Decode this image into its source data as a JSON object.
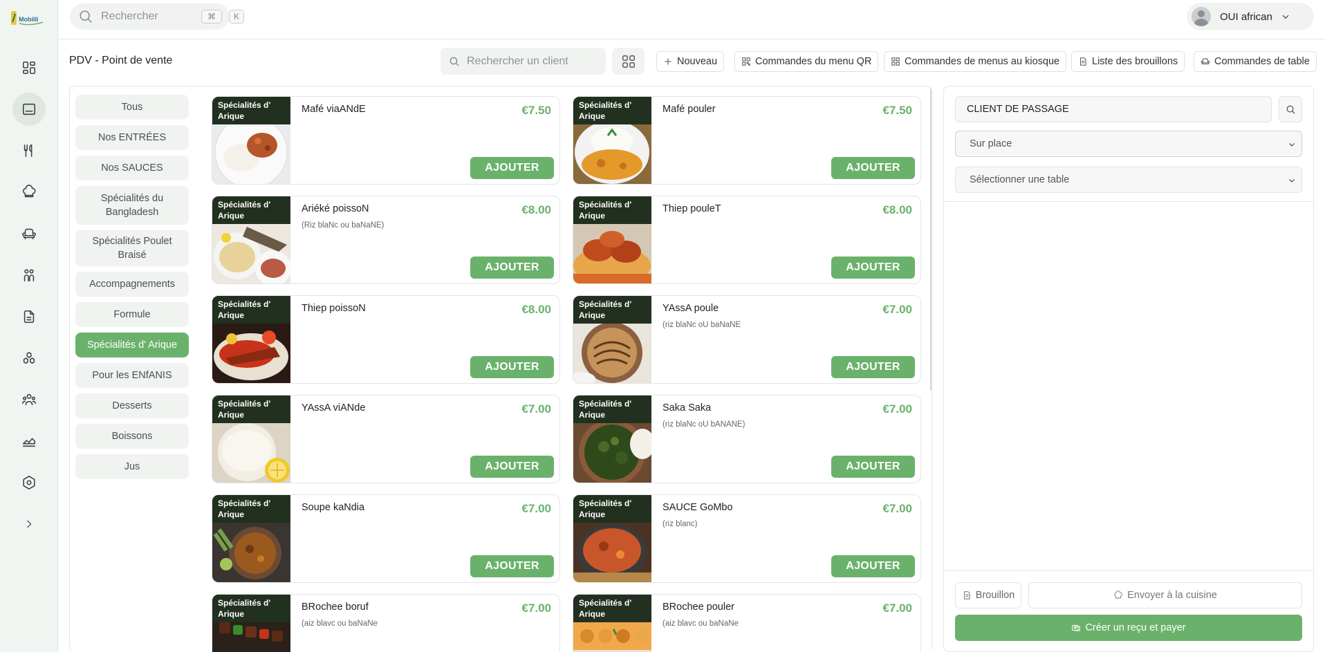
{
  "app": {
    "logo_text": "Mobilli"
  },
  "topbar": {
    "search_placeholder": "Rechercher",
    "shortcut_mod": "⌘",
    "shortcut_key": "K",
    "user_name": "OUI african"
  },
  "nav_icons": [
    "dashboard-icon",
    "pos-icon",
    "utensils-icon",
    "chef-hat-icon",
    "armchair-icon",
    "users-icon",
    "document-icon",
    "stock-icon",
    "team-icon",
    "analytics-icon",
    "settings-icon",
    "expand-icon"
  ],
  "header": {
    "title": "PDV - Point de vente",
    "client_search_placeholder": "Rechercher un client",
    "buttons": {
      "new": "Nouveau",
      "qr_orders": "Commandes du menu QR",
      "kiosk_orders": "Commandes de menus au kiosque",
      "drafts": "Liste des brouillons",
      "table_orders": "Commandes de table"
    }
  },
  "categories": [
    "Tous",
    "Nos ENTRÉES",
    "Nos SAUCES",
    "Spécialités du Bangladesh",
    "Spécialités Poulet Braisé",
    "Accompagnements",
    "Formule",
    "Spécialités d' Arique",
    "Pour les ENfANIS",
    "Desserts",
    "Boissons",
    "Jus"
  ],
  "active_category": "Spécialités d' Arique",
  "product_tag": "Spécialités d' Arique",
  "add_label": "AJOUTER",
  "products": [
    {
      "name": "Mafé viaANdE",
      "desc": "",
      "price": "€7.50",
      "img": "meat-rice"
    },
    {
      "name": "Mafé pouler",
      "desc": "",
      "price": "€7.50",
      "img": "curry-rice"
    },
    {
      "name": "Ariéké poissoN",
      "desc": "(Riz blaNc ou baNaNE)",
      "price": "€8.00",
      "img": "fish-plate"
    },
    {
      "name": "Thiep pouleT",
      "desc": "",
      "price": "€8.00",
      "img": "chicken"
    },
    {
      "name": "Thiep poissoN",
      "desc": "",
      "price": "€8.00",
      "img": "fish-red"
    },
    {
      "name": "YAssA poule",
      "desc": "(riz blaNc oU baNaNE",
      "price": "€7.00",
      "img": "onion-bowl"
    },
    {
      "name": "YAssA viANde",
      "desc": "",
      "price": "€7.00",
      "img": "rice-lemon"
    },
    {
      "name": "Saka Saka",
      "desc": "(riz blaNc oU bANANE)",
      "price": "€7.00",
      "img": "greens"
    },
    {
      "name": "Soupe kaNdia",
      "desc": "",
      "price": "€7.00",
      "img": "soup"
    },
    {
      "name": "SAUCE GoMbo",
      "desc": "(riz blanc)",
      "price": "€7.00",
      "img": "stew"
    },
    {
      "name": "BRochee boruf",
      "desc": "(aiz blavc ou baNaNe",
      "price": "€7.00",
      "img": "skewer-beef"
    },
    {
      "name": "BRochee pouler",
      "desc": "(aiz blavc ou baNaNe",
      "price": "€7.00",
      "img": "skewer-chicken"
    }
  ],
  "cart": {
    "client": "CLIENT DE PASSAGE",
    "service_mode": "Sur place",
    "table_placeholder": "Sélectionner une table",
    "draft_label": "Brouillon",
    "kitchen_label": "Envoyer à la cuisine",
    "pay_label": "Créer un reçu et payer"
  },
  "colors": {
    "accent": "#6ab26b",
    "tag_bg": "#22301f",
    "rail_bg": "#f1f5f1"
  }
}
